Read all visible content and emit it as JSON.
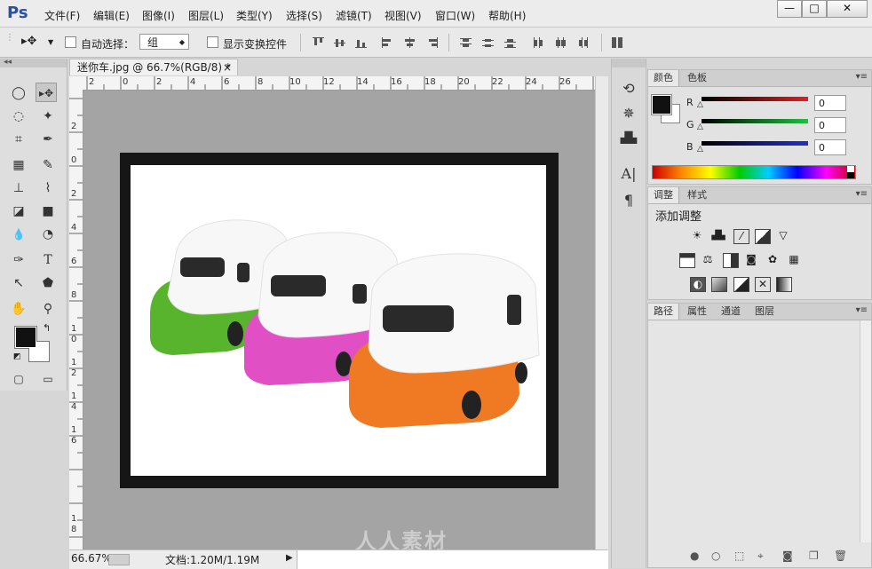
{
  "app": {
    "logo": "Ps"
  },
  "menu": [
    "文件(F)",
    "编辑(E)",
    "图像(I)",
    "图层(L)",
    "类型(Y)",
    "选择(S)",
    "滤镜(T)",
    "视图(V)",
    "窗口(W)",
    "帮助(H)"
  ],
  "window_controls": {
    "minimize": "—",
    "restore": "□",
    "close": "✕"
  },
  "options_bar": {
    "move_tool_glyph": "▸✥",
    "auto_select_label": "自动选择：",
    "auto_select_value": "组",
    "show_transform_label": "显示变换控件"
  },
  "toolbox": {
    "glyphs": [
      "◯",
      "▸✥",
      "◌",
      "✦",
      "⌗",
      "✒",
      "▦",
      "✎",
      "⊥",
      "⌇",
      "◪",
      "■",
      "💧",
      "◔",
      "✑",
      "T",
      "↖",
      "⬟",
      "✋",
      "⚲",
      "▢",
      "▭"
    ]
  },
  "document": {
    "tab_title": "迷你车.jpg @ 66.7%(RGB/8) *",
    "tab_close": "×",
    "ruler_top_labels": [
      "2",
      "0",
      "2",
      "4",
      "6",
      "8",
      "10",
      "12",
      "14",
      "16",
      "18",
      "20",
      "22",
      "24",
      "26"
    ],
    "ruler_left_labels": [
      "2",
      "0",
      "2",
      "4",
      "6",
      "8",
      "1",
      "0",
      "1",
      "2",
      "1",
      "4",
      "1",
      "6",
      "1",
      "8"
    ],
    "zoom": "66.67%",
    "doc_info": "文档:1.20M/1.19M",
    "status_arrow": "▶",
    "watermark": "人人素材"
  },
  "icon_strip": [
    "history-icon",
    "navigator-icon",
    "histogram-icon",
    "character-icon",
    "paragraph-icon"
  ],
  "color_panel": {
    "tabs": [
      "颜色",
      "色板"
    ],
    "channels": [
      {
        "label": "R",
        "value": "0",
        "color": "#e02020"
      },
      {
        "label": "G",
        "value": "0",
        "color": "#20c040"
      },
      {
        "label": "B",
        "value": "0",
        "color": "#2030d0"
      }
    ],
    "foreground": "#111111",
    "background": "#ffffff"
  },
  "adjust_panel": {
    "tabs": [
      "调整",
      "样式"
    ],
    "heading": "添加调整",
    "row1": [
      "brightness-icon",
      "levels-icon",
      "curves-icon",
      "exposure-icon",
      "vibrance-icon"
    ],
    "row2": [
      "hue-sat-icon",
      "color-balance-icon",
      "black-white-icon",
      "photo-filter-icon",
      "channel-mixer-icon",
      "color-lookup-icon"
    ],
    "row3": [
      "invert-icon",
      "posterize-icon",
      "threshold-icon",
      "selective-color-icon",
      "gradient-map-icon"
    ]
  },
  "layers_panel": {
    "tabs": [
      "路径",
      "属性",
      "通道",
      "图层"
    ],
    "footer_icons": [
      "fill-path-icon",
      "stroke-path-icon",
      "load-selection-icon",
      "make-work-path-icon",
      "add-mask-icon",
      "new-path-icon",
      "delete-icon"
    ]
  }
}
